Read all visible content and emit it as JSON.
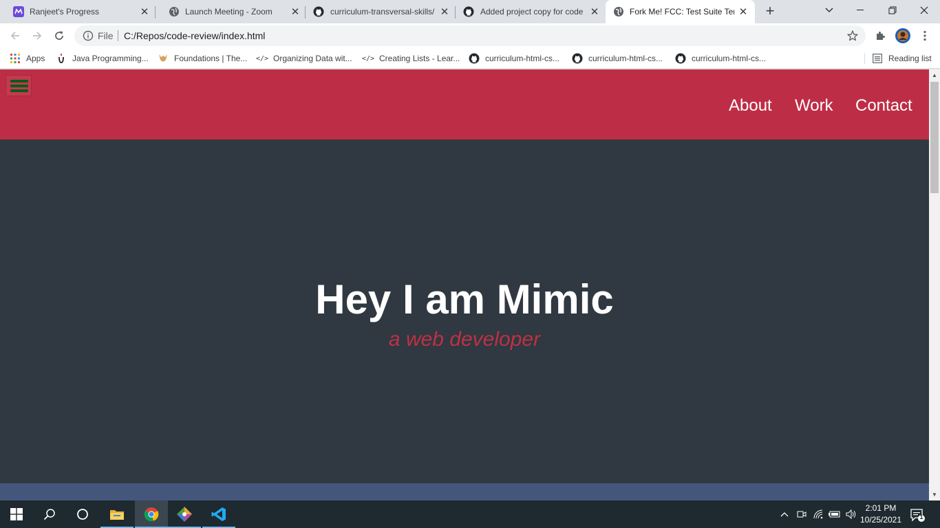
{
  "browser": {
    "tabs": [
      {
        "title": "Ranjeet's Progress",
        "icon": "mimo-icon"
      },
      {
        "title": "Launch Meeting - Zoom",
        "icon": "globe-icon"
      },
      {
        "title": "curriculum-transversal-skills/",
        "icon": "github-icon"
      },
      {
        "title": "Added project copy for code",
        "icon": "github-icon"
      },
      {
        "title": "Fork Me! FCC: Test Suite Tem",
        "icon": "globe-icon"
      }
    ],
    "active_tab_index": 4,
    "omnibox": {
      "scheme_label": "File",
      "url": "C:/Repos/code-review/index.html"
    },
    "bookmarks": [
      {
        "label": "Apps",
        "icon": "apps-grid-icon"
      },
      {
        "label": "Java Programming...",
        "icon": "java-icon"
      },
      {
        "label": "Foundations | The...",
        "icon": "odin-icon"
      },
      {
        "label": "Organizing Data wit...",
        "icon": "code-brackets-icon"
      },
      {
        "label": "Creating Lists - Lear...",
        "icon": "code-brackets-icon"
      },
      {
        "label": "curriculum-html-cs...",
        "icon": "github-icon"
      },
      {
        "label": "curriculum-html-cs...",
        "icon": "github-icon"
      },
      {
        "label": "curriculum-html-cs...",
        "icon": "github-icon"
      }
    ],
    "reading_list": "Reading list"
  },
  "page": {
    "nav_links": [
      "About",
      "Work",
      "Contact"
    ],
    "hero_title": "Hey I am Mimic",
    "hero_subtitle": "a web developer",
    "colors": {
      "nav_bg": "#be2d46",
      "hero_bg": "#303841",
      "accent": "#be3144",
      "hamburger_lines": "#0b5a1c",
      "next_section_bg": "#45567d"
    }
  },
  "taskbar": {
    "apps": [
      "file-explorer-icon",
      "chrome-icon",
      "git-icon",
      "vscode-icon"
    ],
    "clock_time": "2:01 PM",
    "clock_date": "10/25/2021",
    "notification_count": "1"
  }
}
